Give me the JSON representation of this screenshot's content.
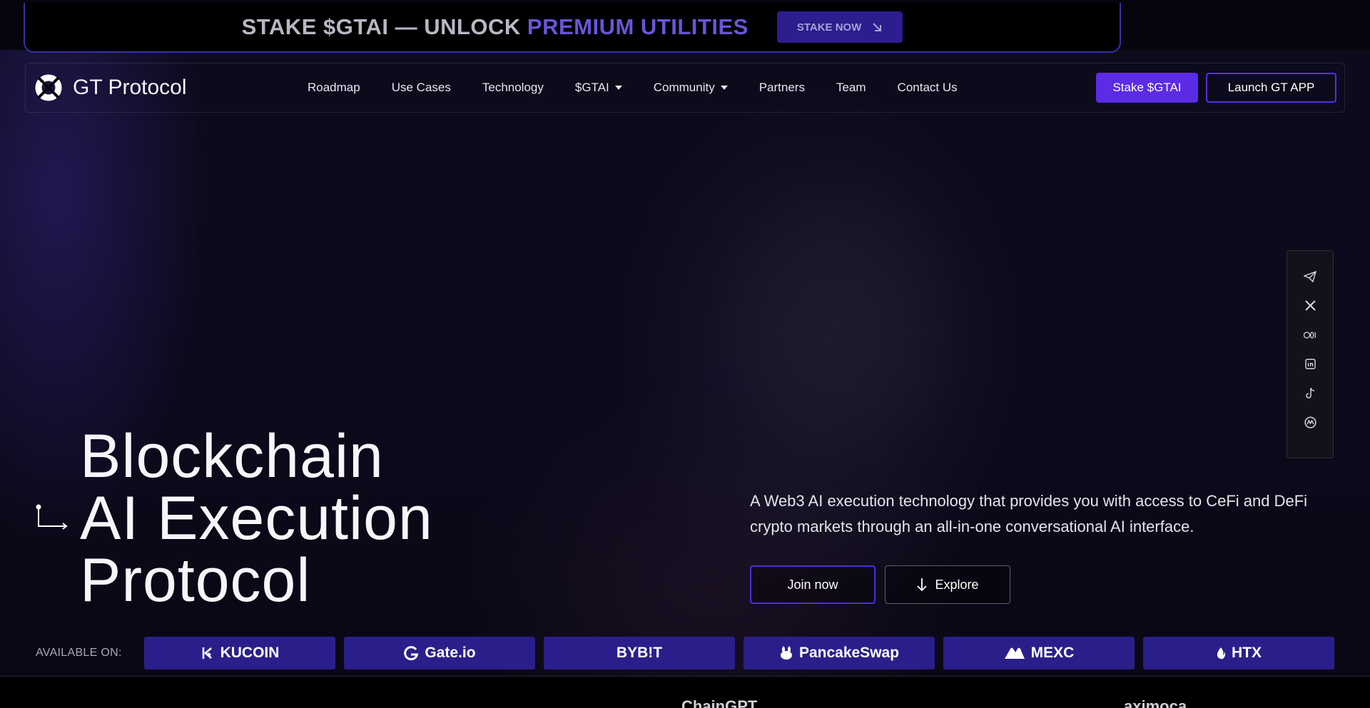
{
  "promo": {
    "text_prefix": "STAKE $GTAI — UNLOCK ",
    "text_highlight": "PREMIUM UTILITIES",
    "button_label": "STAKE NOW",
    "button_icon": "arrow-down-right-icon",
    "highlight_color": "#6a55d8"
  },
  "header": {
    "brand": "GT Protocol",
    "logo_icon": "ring-logo-icon",
    "nav": [
      {
        "label": "Roadmap"
      },
      {
        "label": "Use Cases"
      },
      {
        "label": "Technology"
      },
      {
        "label": "$GTAI",
        "dropdown": true
      },
      {
        "label": "Community",
        "dropdown": true
      },
      {
        "label": "Partners"
      },
      {
        "label": "Team"
      },
      {
        "label": "Contact Us"
      }
    ],
    "stake_button": "Stake $GTAI",
    "launch_button": "Launch GT APP",
    "accent_color": "#5b2be6"
  },
  "social": [
    {
      "name": "telegram-icon",
      "glyph": "◁"
    },
    {
      "name": "x-icon",
      "glyph": "✕"
    },
    {
      "name": "medium-icon",
      "glyph": "●●|"
    },
    {
      "name": "linkedin-icon",
      "glyph": "in"
    },
    {
      "name": "tiktok-icon",
      "glyph": "♪"
    },
    {
      "name": "coinmarketcap-icon",
      "glyph": "Ⓜ"
    }
  ],
  "hero": {
    "headline_lines": [
      "Blockchain",
      "AI Execution",
      "Protocol"
    ],
    "description": "A Web3 AI execution technology that provides you with access to CeFi and DeFi crypto markets through an all-in-one conversational AI interface.",
    "join_button": "Join now",
    "explore_button": "Explore",
    "explore_icon": "arrow-down-icon"
  },
  "exchanges": {
    "label": "AVAILABLE ON:",
    "items": [
      {
        "name": "KUCOIN",
        "icon": "kucoin-icon",
        "glyph": "⟨K"
      },
      {
        "name": "Gate.io",
        "icon": "gateio-icon",
        "glyph": "G"
      },
      {
        "name": "BYB!T",
        "icon": "bybit-icon",
        "glyph": ""
      },
      {
        "name": "PancakeSwap",
        "icon": "pancakeswap-icon",
        "glyph": "🐰"
      },
      {
        "name": "MEXC",
        "icon": "mexc-icon",
        "glyph": "▲▲"
      },
      {
        "name": "HTX",
        "icon": "htx-icon",
        "glyph": "🔥"
      }
    ]
  },
  "partners_strip": [
    "ChainGPT",
    "aximoca"
  ]
}
